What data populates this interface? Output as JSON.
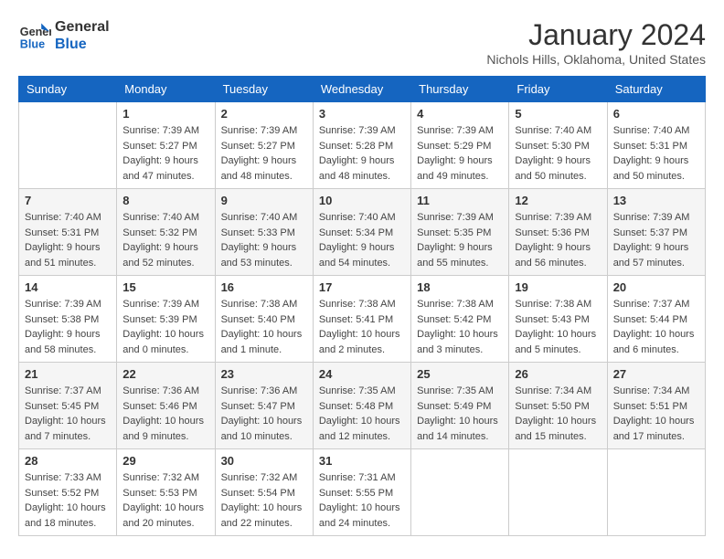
{
  "logo": {
    "line1": "General",
    "line2": "Blue"
  },
  "title": "January 2024",
  "location": "Nichols Hills, Oklahoma, United States",
  "weekdays": [
    "Sunday",
    "Monday",
    "Tuesday",
    "Wednesday",
    "Thursday",
    "Friday",
    "Saturday"
  ],
  "weeks": [
    [
      {
        "day": "",
        "sunrise": "",
        "sunset": "",
        "daylight": ""
      },
      {
        "day": "1",
        "sunrise": "Sunrise: 7:39 AM",
        "sunset": "Sunset: 5:27 PM",
        "daylight": "Daylight: 9 hours and 47 minutes."
      },
      {
        "day": "2",
        "sunrise": "Sunrise: 7:39 AM",
        "sunset": "Sunset: 5:27 PM",
        "daylight": "Daylight: 9 hours and 48 minutes."
      },
      {
        "day": "3",
        "sunrise": "Sunrise: 7:39 AM",
        "sunset": "Sunset: 5:28 PM",
        "daylight": "Daylight: 9 hours and 48 minutes."
      },
      {
        "day": "4",
        "sunrise": "Sunrise: 7:39 AM",
        "sunset": "Sunset: 5:29 PM",
        "daylight": "Daylight: 9 hours and 49 minutes."
      },
      {
        "day": "5",
        "sunrise": "Sunrise: 7:40 AM",
        "sunset": "Sunset: 5:30 PM",
        "daylight": "Daylight: 9 hours and 50 minutes."
      },
      {
        "day": "6",
        "sunrise": "Sunrise: 7:40 AM",
        "sunset": "Sunset: 5:31 PM",
        "daylight": "Daylight: 9 hours and 50 minutes."
      }
    ],
    [
      {
        "day": "7",
        "sunrise": "Sunrise: 7:40 AM",
        "sunset": "Sunset: 5:31 PM",
        "daylight": "Daylight: 9 hours and 51 minutes."
      },
      {
        "day": "8",
        "sunrise": "Sunrise: 7:40 AM",
        "sunset": "Sunset: 5:32 PM",
        "daylight": "Daylight: 9 hours and 52 minutes."
      },
      {
        "day": "9",
        "sunrise": "Sunrise: 7:40 AM",
        "sunset": "Sunset: 5:33 PM",
        "daylight": "Daylight: 9 hours and 53 minutes."
      },
      {
        "day": "10",
        "sunrise": "Sunrise: 7:40 AM",
        "sunset": "Sunset: 5:34 PM",
        "daylight": "Daylight: 9 hours and 54 minutes."
      },
      {
        "day": "11",
        "sunrise": "Sunrise: 7:39 AM",
        "sunset": "Sunset: 5:35 PM",
        "daylight": "Daylight: 9 hours and 55 minutes."
      },
      {
        "day": "12",
        "sunrise": "Sunrise: 7:39 AM",
        "sunset": "Sunset: 5:36 PM",
        "daylight": "Daylight: 9 hours and 56 minutes."
      },
      {
        "day": "13",
        "sunrise": "Sunrise: 7:39 AM",
        "sunset": "Sunset: 5:37 PM",
        "daylight": "Daylight: 9 hours and 57 minutes."
      }
    ],
    [
      {
        "day": "14",
        "sunrise": "Sunrise: 7:39 AM",
        "sunset": "Sunset: 5:38 PM",
        "daylight": "Daylight: 9 hours and 58 minutes."
      },
      {
        "day": "15",
        "sunrise": "Sunrise: 7:39 AM",
        "sunset": "Sunset: 5:39 PM",
        "daylight": "Daylight: 10 hours and 0 minutes."
      },
      {
        "day": "16",
        "sunrise": "Sunrise: 7:38 AM",
        "sunset": "Sunset: 5:40 PM",
        "daylight": "Daylight: 10 hours and 1 minute."
      },
      {
        "day": "17",
        "sunrise": "Sunrise: 7:38 AM",
        "sunset": "Sunset: 5:41 PM",
        "daylight": "Daylight: 10 hours and 2 minutes."
      },
      {
        "day": "18",
        "sunrise": "Sunrise: 7:38 AM",
        "sunset": "Sunset: 5:42 PM",
        "daylight": "Daylight: 10 hours and 3 minutes."
      },
      {
        "day": "19",
        "sunrise": "Sunrise: 7:38 AM",
        "sunset": "Sunset: 5:43 PM",
        "daylight": "Daylight: 10 hours and 5 minutes."
      },
      {
        "day": "20",
        "sunrise": "Sunrise: 7:37 AM",
        "sunset": "Sunset: 5:44 PM",
        "daylight": "Daylight: 10 hours and 6 minutes."
      }
    ],
    [
      {
        "day": "21",
        "sunrise": "Sunrise: 7:37 AM",
        "sunset": "Sunset: 5:45 PM",
        "daylight": "Daylight: 10 hours and 7 minutes."
      },
      {
        "day": "22",
        "sunrise": "Sunrise: 7:36 AM",
        "sunset": "Sunset: 5:46 PM",
        "daylight": "Daylight: 10 hours and 9 minutes."
      },
      {
        "day": "23",
        "sunrise": "Sunrise: 7:36 AM",
        "sunset": "Sunset: 5:47 PM",
        "daylight": "Daylight: 10 hours and 10 minutes."
      },
      {
        "day": "24",
        "sunrise": "Sunrise: 7:35 AM",
        "sunset": "Sunset: 5:48 PM",
        "daylight": "Daylight: 10 hours and 12 minutes."
      },
      {
        "day": "25",
        "sunrise": "Sunrise: 7:35 AM",
        "sunset": "Sunset: 5:49 PM",
        "daylight": "Daylight: 10 hours and 14 minutes."
      },
      {
        "day": "26",
        "sunrise": "Sunrise: 7:34 AM",
        "sunset": "Sunset: 5:50 PM",
        "daylight": "Daylight: 10 hours and 15 minutes."
      },
      {
        "day": "27",
        "sunrise": "Sunrise: 7:34 AM",
        "sunset": "Sunset: 5:51 PM",
        "daylight": "Daylight: 10 hours and 17 minutes."
      }
    ],
    [
      {
        "day": "28",
        "sunrise": "Sunrise: 7:33 AM",
        "sunset": "Sunset: 5:52 PM",
        "daylight": "Daylight: 10 hours and 18 minutes."
      },
      {
        "day": "29",
        "sunrise": "Sunrise: 7:32 AM",
        "sunset": "Sunset: 5:53 PM",
        "daylight": "Daylight: 10 hours and 20 minutes."
      },
      {
        "day": "30",
        "sunrise": "Sunrise: 7:32 AM",
        "sunset": "Sunset: 5:54 PM",
        "daylight": "Daylight: 10 hours and 22 minutes."
      },
      {
        "day": "31",
        "sunrise": "Sunrise: 7:31 AM",
        "sunset": "Sunset: 5:55 PM",
        "daylight": "Daylight: 10 hours and 24 minutes."
      },
      {
        "day": "",
        "sunrise": "",
        "sunset": "",
        "daylight": ""
      },
      {
        "day": "",
        "sunrise": "",
        "sunset": "",
        "daylight": ""
      },
      {
        "day": "",
        "sunrise": "",
        "sunset": "",
        "daylight": ""
      }
    ]
  ]
}
